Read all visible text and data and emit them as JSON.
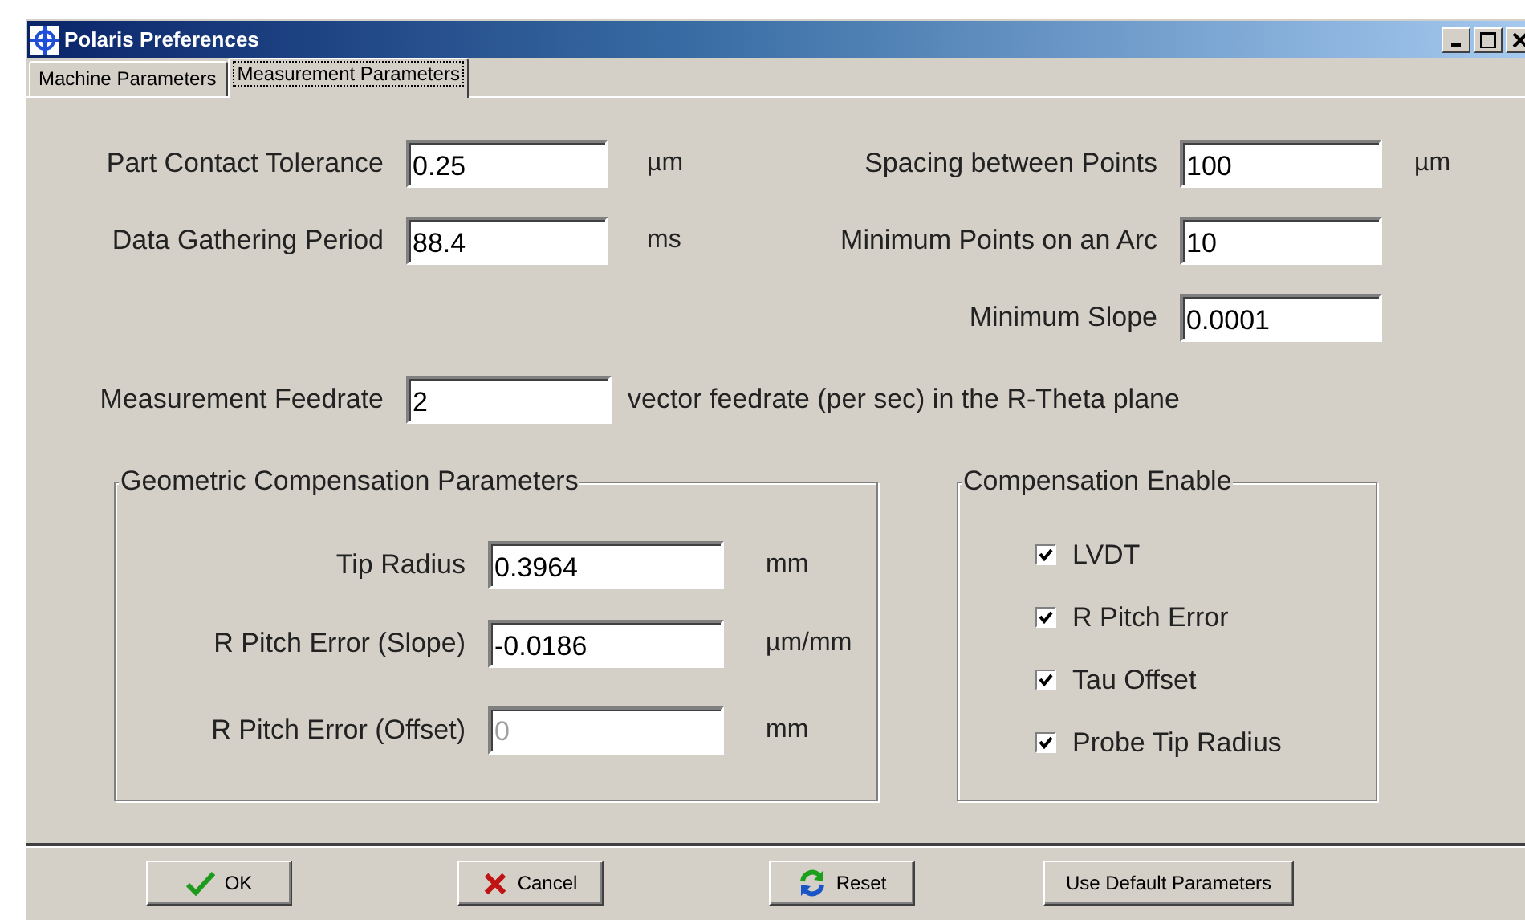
{
  "window": {
    "title": "Polaris Preferences"
  },
  "tabs": [
    {
      "label": "Machine Parameters",
      "selected": false
    },
    {
      "label": "Measurement Parameters",
      "selected": true
    }
  ],
  "left_fields": [
    {
      "label": "Part Contact Tolerance",
      "value": "0.25",
      "unit": "µm"
    },
    {
      "label": "Data Gathering Period",
      "value": "88.4",
      "unit": "ms"
    }
  ],
  "right_fields": [
    {
      "label": "Spacing between Points",
      "value": "100",
      "unit": "µm"
    },
    {
      "label": "Minimum Points on an Arc",
      "value": "10"
    },
    {
      "label": "Minimum Slope",
      "value": "0.0001"
    }
  ],
  "feedrate": {
    "label": "Measurement Feedrate",
    "value": "2",
    "note": "vector feedrate (per sec) in the R-Theta plane"
  },
  "geometric_compensation": {
    "title": "Geometric Compensation Parameters",
    "fields": [
      {
        "label": "Tip Radius",
        "value": "0.3964",
        "unit": "mm",
        "disabled": false
      },
      {
        "label": "R Pitch Error (Slope)",
        "value": "-0.0186",
        "unit": "µm/mm",
        "disabled": false
      },
      {
        "label": "R Pitch Error (Offset)",
        "value": "0",
        "unit": "mm",
        "disabled": true
      }
    ]
  },
  "compensation_enable": {
    "title": "Compensation Enable",
    "options": [
      {
        "label": "LVDT",
        "checked": true
      },
      {
        "label": "R Pitch Error",
        "checked": true
      },
      {
        "label": "Tau Offset",
        "checked": true
      },
      {
        "label": "Probe Tip Radius",
        "checked": true
      }
    ]
  },
  "buttons": [
    {
      "label": "OK",
      "kind": "ok"
    },
    {
      "label": "Cancel",
      "kind": "cancel"
    },
    {
      "label": "Reset",
      "kind": "reset"
    },
    {
      "label": "Use Default Parameters",
      "kind": "plain"
    }
  ]
}
